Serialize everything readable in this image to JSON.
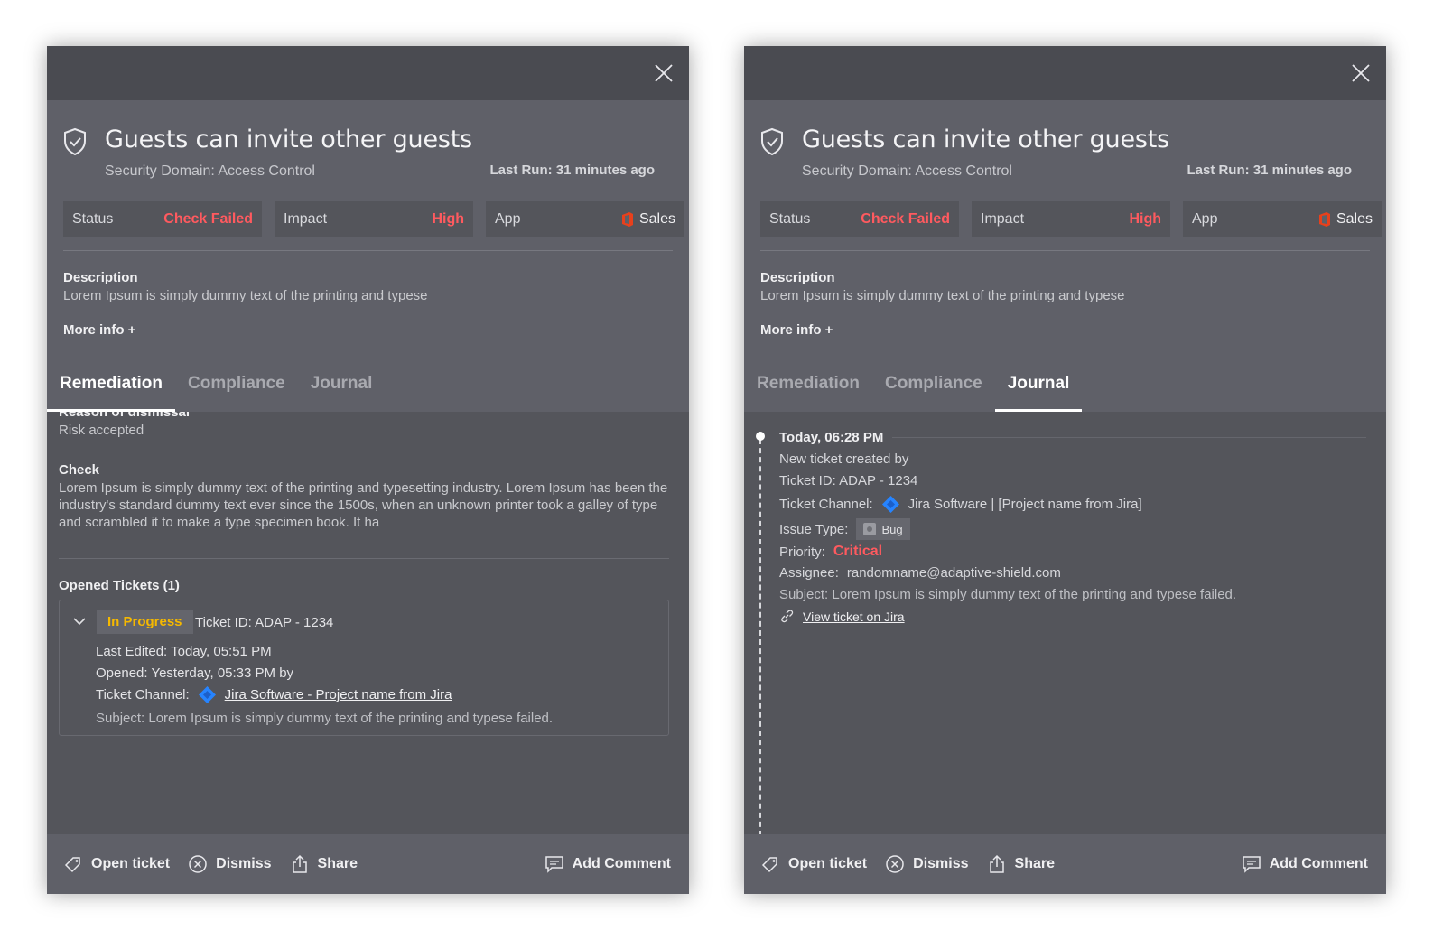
{
  "panels": [
    {
      "title": "Guests can invite other guests",
      "security_domain": "Security Domain: Access Control",
      "last_run": "Last Run: 31 minutes ago",
      "chips": {
        "status_label": "Status",
        "status_value": "Check Failed",
        "impact_label": "Impact",
        "impact_value": "High",
        "app_label": "App",
        "app_value": "Sales"
      },
      "description_label": "Description",
      "description_text": "Lorem Ipsum is simply dummy text of the printing and typese",
      "more_info": "More info +",
      "tabs": [
        "Remediation",
        "Compliance",
        "Journal"
      ],
      "active_tab": "Remediation",
      "remediation": {
        "reason_label": "Reason of dismissal",
        "reason_value": "Risk accepted",
        "check_label": "Check",
        "check_text": "Lorem Ipsum is simply dummy text of the printing and typesetting industry. Lorem Ipsum has been the industry's standard dummy text ever since the 1500s, when an unknown printer took a galley of type and scrambled it to make a type specimen book. It ha",
        "opened_tickets_label": "Opened Tickets (1)",
        "ticket": {
          "status": "In Progress",
          "ticket_id": "Ticket ID: ADAP - 1234",
          "last_edited": "Last Edited: Today, 05:51 PM",
          "opened": "Opened: Yesterday, 05:33 PM by",
          "channel_label": "Ticket Channel:",
          "channel_link": "Jira Software - Project name from Jira",
          "subject": "Subject: Lorem Ipsum is simply dummy text of the printing and typese failed."
        }
      },
      "footer": {
        "open_ticket": "Open ticket",
        "dismiss": "Dismiss",
        "share": "Share",
        "add_comment": "Add Comment"
      }
    },
    {
      "title": "Guests can invite other guests",
      "security_domain": "Security Domain: Access Control",
      "last_run": "Last Run: 31 minutes ago",
      "chips": {
        "status_label": "Status",
        "status_value": "Check Failed",
        "impact_label": "Impact",
        "impact_value": "High",
        "app_label": "App",
        "app_value": "Sales"
      },
      "description_label": "Description",
      "description_text": "Lorem Ipsum is simply dummy text of the printing and typese",
      "more_info": "More info +",
      "tabs": [
        "Remediation",
        "Compliance",
        "Journal"
      ],
      "active_tab": "Journal",
      "journal": {
        "time": "Today, 06:28 PM",
        "created_by": "New ticket created by",
        "ticket_id": "Ticket ID: ADAP - 1234",
        "channel_label": "Ticket Channel:",
        "channel_value": "Jira Software | [Project name from Jira]",
        "issue_type_label": "Issue Type:",
        "issue_type_value": "Bug",
        "priority_label": "Priority:",
        "priority_value": "Critical",
        "assignee_label": "Assignee:",
        "assignee_value": "randomname@adaptive-shield.com",
        "subject": "Subject: Lorem Ipsum is simply dummy text of the printing and typese  failed.",
        "view_link": "View ticket on Jira"
      },
      "footer": {
        "open_ticket": "Open ticket",
        "dismiss": "Dismiss",
        "share": "Share",
        "add_comment": "Add Comment"
      }
    }
  ],
  "colors": {
    "critical_red": "#ff5a5f",
    "in_progress_yellow": "#f5b800",
    "panel_bg": "#54555b",
    "header_bg": "#5f6068"
  }
}
